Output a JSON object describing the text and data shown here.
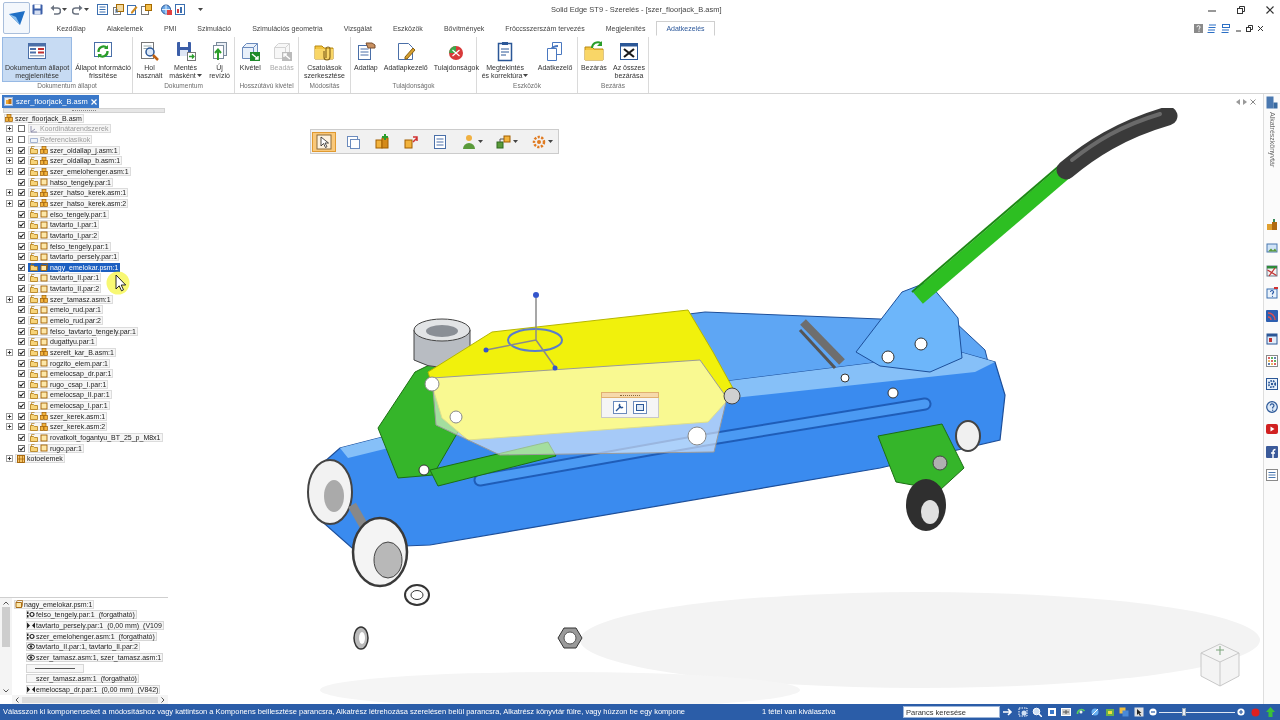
{
  "window": {
    "title": "Solid Edge ST9 - Szerelés - [szer_floorjack_B.asm]"
  },
  "ribbon_tabs": [
    {
      "label": "Kezdőlap",
      "selected": false
    },
    {
      "label": "Alakelemek",
      "selected": false
    },
    {
      "label": "PMI",
      "selected": false
    },
    {
      "label": "Szimuláció",
      "selected": false
    },
    {
      "label": "Szimulációs geometria",
      "selected": false
    },
    {
      "label": "Vizsgálat",
      "selected": false
    },
    {
      "label": "Eszközök",
      "selected": false
    },
    {
      "label": "Bővítmények",
      "selected": false
    },
    {
      "label": "Fröccsszerszám tervezés",
      "selected": false
    },
    {
      "label": "Megjelenítés",
      "selected": false
    },
    {
      "label": "Adatkezelés",
      "selected": true
    }
  ],
  "ribbon_groups": [
    {
      "label": "Dokumentum állapot",
      "buttons": [
        {
          "label": "Dokumentum állapot\nmegjelenítése",
          "selected": true,
          "disabled": false,
          "dropdown": false
        },
        {
          "label": "Állapot információ\nfrissítése",
          "selected": false,
          "disabled": false,
          "dropdown": false
        }
      ]
    },
    {
      "label": "Dokumentum",
      "buttons": [
        {
          "label": "Hol\nhasznált",
          "selected": false,
          "disabled": false,
          "dropdown": false
        },
        {
          "label": "Mentés\nmásként",
          "selected": false,
          "disabled": false,
          "dropdown": true
        },
        {
          "label": "Új\nrevízió",
          "selected": false,
          "disabled": false,
          "dropdown": false
        }
      ]
    },
    {
      "label": "Hosszútávú kivétel",
      "buttons": [
        {
          "label": "Kivétel",
          "selected": false,
          "disabled": false,
          "dropdown": false
        },
        {
          "label": "Beadás",
          "selected": false,
          "disabled": true,
          "dropdown": false
        }
      ]
    },
    {
      "label": "Módosítás",
      "buttons": [
        {
          "label": "Csatolások\nszerkesztése",
          "selected": false,
          "disabled": false,
          "dropdown": false
        }
      ]
    },
    {
      "label": "Tulajdonságok",
      "buttons": [
        {
          "label": "Adatlap",
          "selected": false,
          "disabled": false,
          "dropdown": false
        },
        {
          "label": "Adatlapkezelő",
          "selected": false,
          "disabled": false,
          "dropdown": false
        },
        {
          "label": "Tulajdonságok",
          "selected": false,
          "disabled": false,
          "dropdown": false
        }
      ]
    },
    {
      "label": "Eszközök",
      "buttons": [
        {
          "label": "Megtekintés\nés korrektúra",
          "selected": false,
          "disabled": false,
          "dropdown": true
        },
        {
          "label": "Adatkezelő",
          "selected": false,
          "disabled": false,
          "dropdown": false
        }
      ]
    },
    {
      "label": "Bezárás",
      "buttons": [
        {
          "label": "Bezárás",
          "selected": false,
          "disabled": false,
          "dropdown": false
        },
        {
          "label": "Az összes\nbezárása",
          "selected": false,
          "disabled": false,
          "dropdown": false
        }
      ]
    }
  ],
  "document_tabs": [
    {
      "label": "szer_floorjack_B.asm",
      "selected": true
    }
  ],
  "assembly_tree": {
    "label": "szer_floorjack_B.asm",
    "kind": "assembly",
    "children": [
      {
        "label": "Koordinátarendszerek",
        "kind": "coordinate_systems",
        "expanded": false,
        "checked": false,
        "selected": false
      },
      {
        "label": "Referenciasíkok",
        "kind": "reference_planes",
        "expanded": false,
        "checked": false,
        "selected": false
      },
      {
        "label": "szer_oldallap_j.asm:1",
        "kind": "assembly",
        "expanded": false,
        "checked": true,
        "selected": false
      },
      {
        "label": "szer_oldallap_b.asm:1",
        "kind": "assembly",
        "expanded": false,
        "checked": true,
        "selected": false
      },
      {
        "label": "szer_emelohenger.asm:1",
        "kind": "assembly",
        "expanded": false,
        "checked": true,
        "selected": false
      },
      {
        "label": "hatso_tengely.par:1",
        "kind": "part",
        "checked": true,
        "selected": false
      },
      {
        "label": "szer_hatso_kerek.asm:1",
        "kind": "assembly",
        "expanded": false,
        "checked": true,
        "selected": false
      },
      {
        "label": "szer_hatso_kerek.asm:2",
        "kind": "assembly",
        "expanded": false,
        "checked": true,
        "selected": false
      },
      {
        "label": "elso_tengely.par:1",
        "kind": "part",
        "checked": true,
        "selected": false
      },
      {
        "label": "tavtarto_I.par:1",
        "kind": "part",
        "checked": true,
        "selected": false
      },
      {
        "label": "tavtarto_I.par:2",
        "kind": "part",
        "checked": true,
        "selected": false
      },
      {
        "label": "felso_tengely.par:1",
        "kind": "part",
        "checked": true,
        "selected": false
      },
      {
        "label": "tavtarto_persely.par:1",
        "kind": "part",
        "checked": true,
        "selected": false
      },
      {
        "label": "nagy_emelokar.psm:1",
        "kind": "sheet_metal",
        "checked": true,
        "selected": true
      },
      {
        "label": "tavtarto_II.par:1",
        "kind": "part",
        "checked": true,
        "selected": false
      },
      {
        "label": "tavtarto_II.par:2",
        "kind": "part",
        "checked": true,
        "selected": false
      },
      {
        "label": "szer_tamasz.asm:1",
        "kind": "assembly",
        "expanded": false,
        "checked": true,
        "selected": false
      },
      {
        "label": "emelo_rud.par:1",
        "kind": "part",
        "checked": true,
        "selected": false
      },
      {
        "label": "emelo_rud.par:2",
        "kind": "part",
        "checked": true,
        "selected": false
      },
      {
        "label": "felso_tavtarto_tengely.par:1",
        "kind": "part",
        "checked": true,
        "selected": false
      },
      {
        "label": "dugattyu.par:1",
        "kind": "part",
        "checked": true,
        "selected": false
      },
      {
        "label": "szerelt_kar_B.asm:1",
        "kind": "assembly",
        "expanded": false,
        "checked": true,
        "selected": false
      },
      {
        "label": "rogzito_elem.par:1",
        "kind": "part",
        "checked": true,
        "selected": false
      },
      {
        "label": "emelocsap_dr.par:1",
        "kind": "part",
        "checked": true,
        "selected": false
      },
      {
        "label": "rugo_csap_I.par:1",
        "kind": "part",
        "checked": true,
        "selected": false
      },
      {
        "label": "emelocsap_II.par:1",
        "kind": "part",
        "checked": true,
        "selected": false
      },
      {
        "label": "emelocsap_I.par:1",
        "kind": "part",
        "checked": true,
        "selected": false
      },
      {
        "label": "szer_kerek.asm:1",
        "kind": "assembly",
        "expanded": false,
        "checked": true,
        "selected": false
      },
      {
        "label": "szer_kerek.asm:2",
        "kind": "assembly",
        "expanded": false,
        "checked": true,
        "selected": false
      },
      {
        "label": "rovatkolt_fogantyu_BT_25_p_M8x1",
        "kind": "part",
        "checked": true,
        "selected": false
      },
      {
        "label": "rugo.par:1",
        "kind": "part",
        "checked": true,
        "selected": false
      },
      {
        "label": "kotoelemek",
        "kind": "fasteners",
        "expanded": false,
        "selected": false
      }
    ]
  },
  "relationships": {
    "part": "nagy_emelokar.psm:1",
    "items": [
      {
        "kind": "axial",
        "text": "felso_tengely.par:1",
        "details": [
          "(forgatható)"
        ]
      },
      {
        "kind": "mate",
        "text": "tavtarto_persely.par:1",
        "details": [
          "(0,00 mm)",
          "(V109"
        ]
      },
      {
        "kind": "axial",
        "text": "szer_emelohenger.asm:1",
        "details": [
          "(forgatható)"
        ]
      },
      {
        "kind": "connect",
        "text": "tavtarto_II.par:1, tavtarto_II.par:2"
      },
      {
        "kind": "connect",
        "text": "szer_tamasz.asm:1, szer_tamasz.asm:1"
      },
      {
        "kind": "separator"
      },
      {
        "kind": "plain",
        "text": "szer_tamasz.asm:1",
        "details": [
          "(forgatható)"
        ]
      },
      {
        "kind": "mate",
        "text": "emelocsap_dr.par:1",
        "details": [
          "(0,00 mm)",
          "(V842)"
        ]
      }
    ]
  },
  "command_bar": {
    "tools": [
      {
        "selected": true,
        "dropdown": false
      },
      {
        "selected": false,
        "dropdown": false
      },
      {
        "selected": false,
        "dropdown": false
      },
      {
        "selected": false,
        "dropdown": false
      },
      {
        "selected": false,
        "dropdown": false
      },
      {
        "selected": false,
        "dropdown": true
      },
      {
        "selected": false,
        "dropdown": true
      },
      {
        "selected": false,
        "dropdown": true
      }
    ]
  },
  "side_panel": {
    "tabs": [
      {
        "label": "Alkatrészkönyvtár"
      }
    ]
  },
  "status_bar": {
    "message": "Válasszon ki komponenseket a módosításhoz vagy kattintson a Komponens beillesztése parancsra, Alkatrész létrehozása szerelésen belül parancsra, Alkatrész könyvtár fülre, vagy húzzon be egy kompone",
    "selection": "1 tétel van kiválasztva",
    "command_search": {
      "placeholder": "Parancs keresése"
    },
    "zoom": {
      "level": 0.33
    }
  }
}
